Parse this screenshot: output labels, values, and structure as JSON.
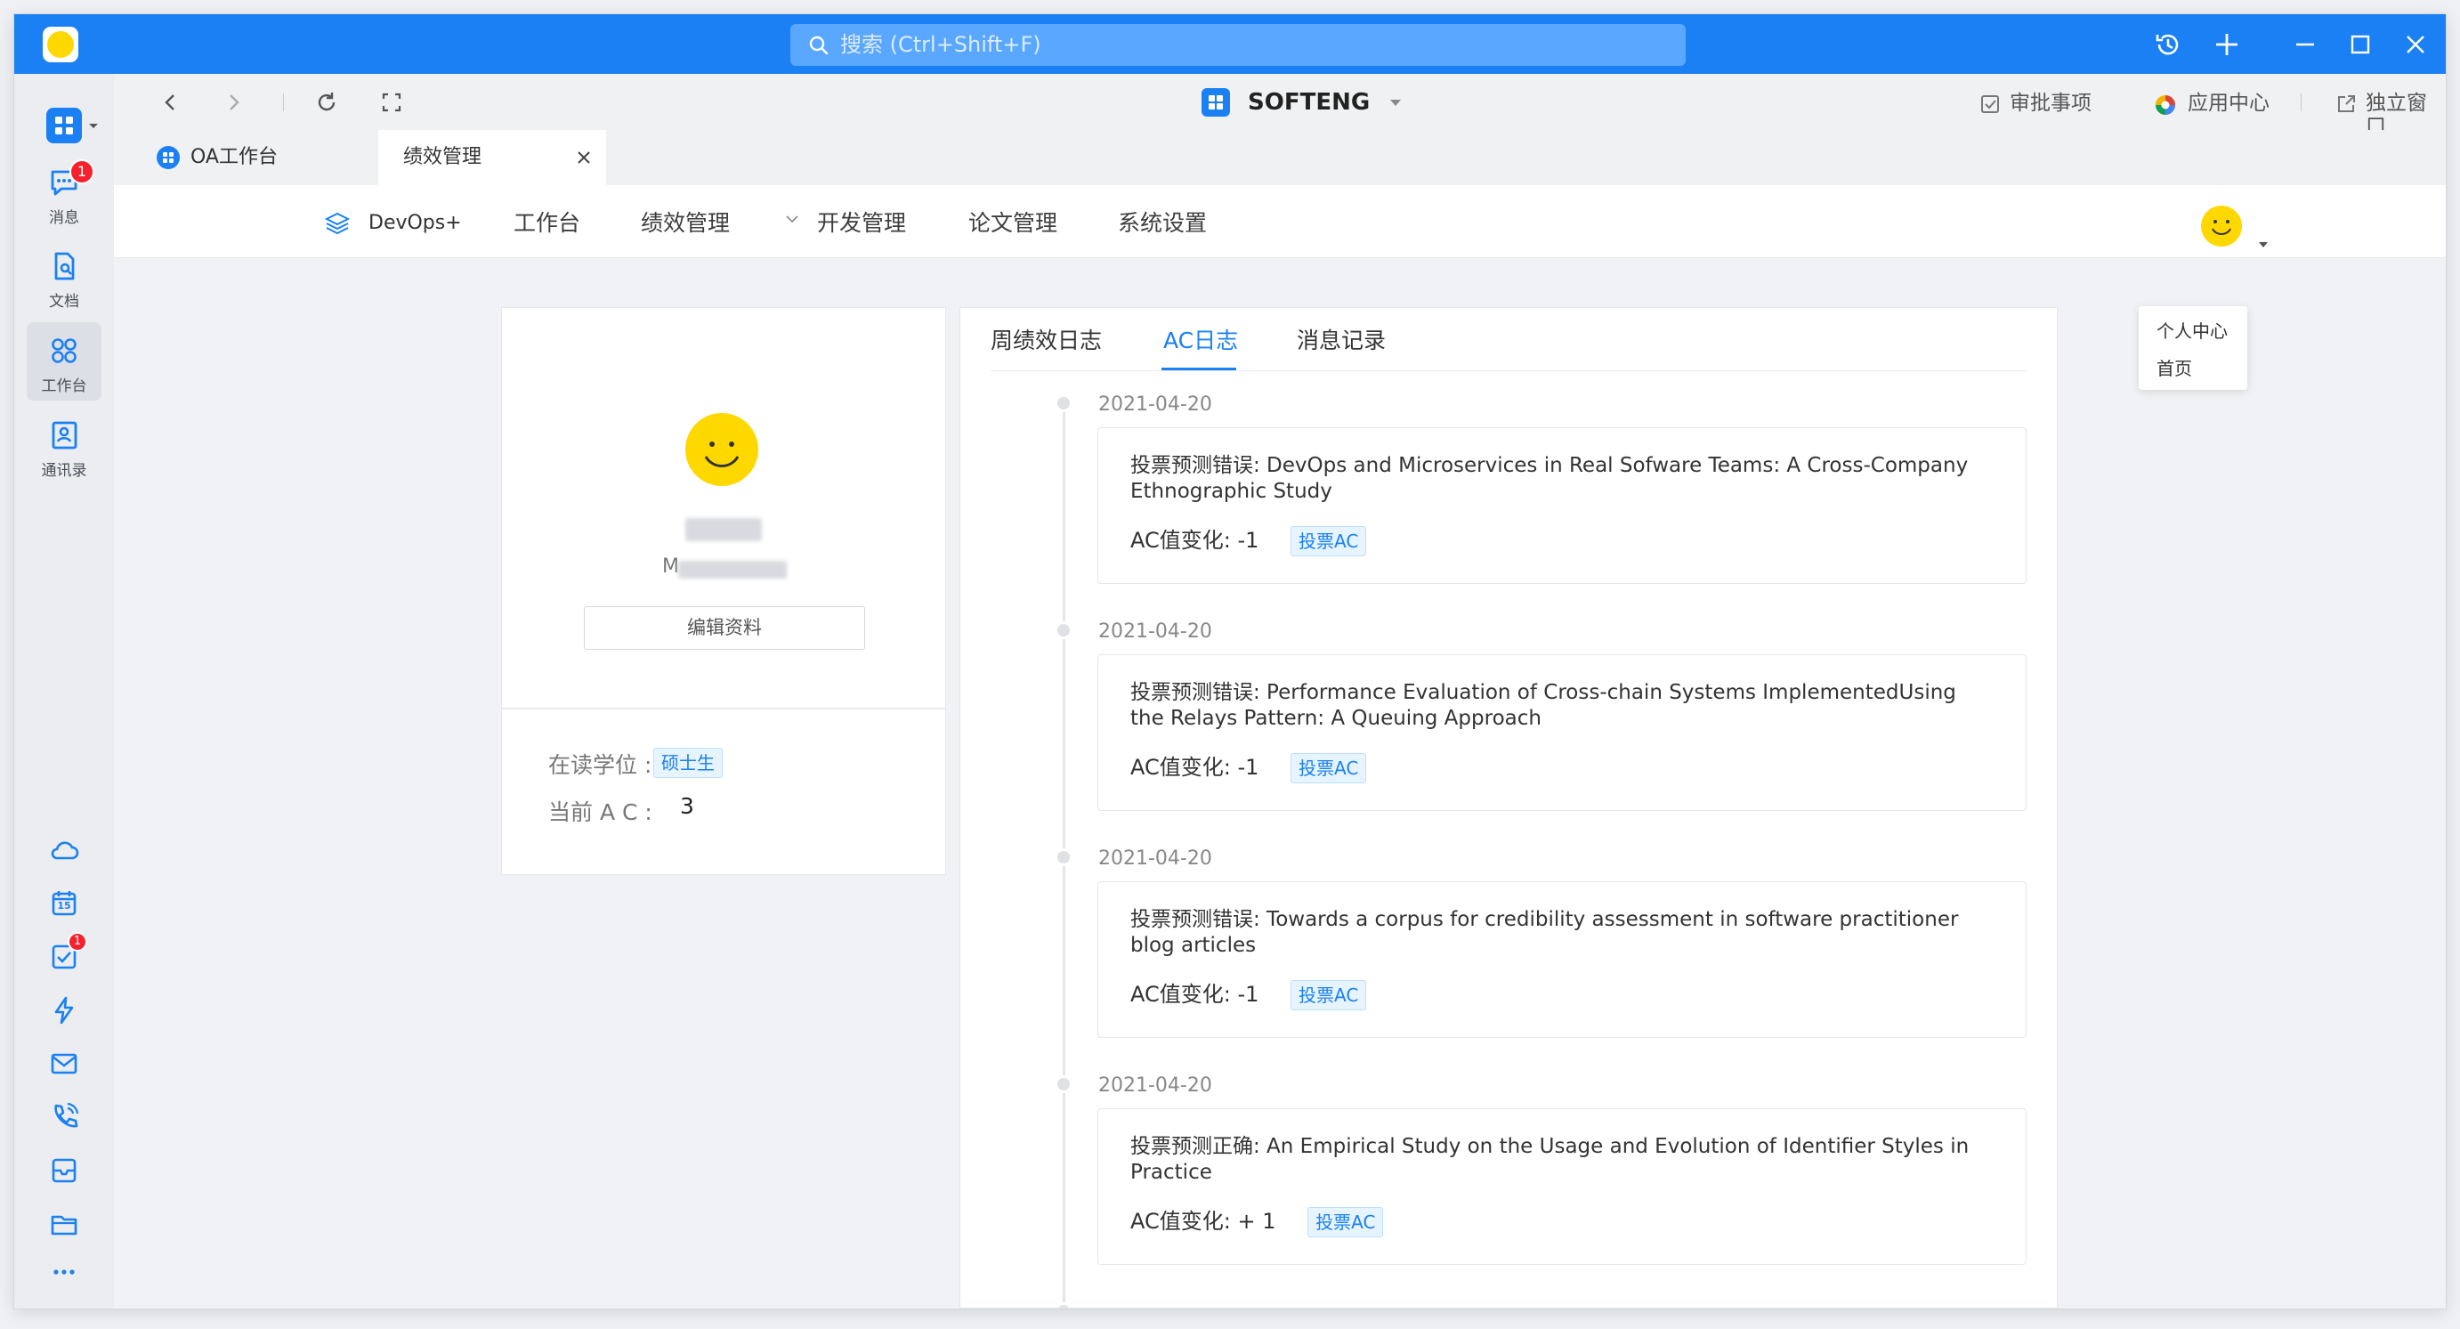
{
  "titlebar": {
    "search_placeholder": "搜索 (Ctrl+Shift+F)"
  },
  "rail": {
    "items": [
      {
        "label": "消息",
        "badge": "1"
      },
      {
        "label": "文档"
      },
      {
        "label": "工作台"
      },
      {
        "label": "通讯录"
      }
    ],
    "calendar_day": "15",
    "task_badge": "1"
  },
  "topbar": {
    "brand": "SOFTENG",
    "approvals": "审批事项",
    "app_center": "应用中心",
    "standalone": "独立窗口"
  },
  "tabs": [
    {
      "label": "OA工作台"
    },
    {
      "label": "绩效管理"
    }
  ],
  "appnav": {
    "logo_text": "DevOps+",
    "items": [
      "工作台",
      "绩效管理",
      "开发管理",
      "论文管理",
      "系统设置"
    ]
  },
  "user_menu": [
    "个人中心",
    "首页"
  ],
  "profile": {
    "id_prefix": "M",
    "edit_label": "编辑资料",
    "degree_label": "在读学位 :",
    "degree_value": "硕士生",
    "ac_label": "当前 A C :",
    "ac_value": "3"
  },
  "log_tabs": [
    "周绩效日志",
    "AC日志",
    "消息记录"
  ],
  "logs": [
    {
      "date": "2021-04-20",
      "title": "投票预测错误:  DevOps and Microservices in Real Sofware Teams: A Cross-Company Ethnographic Study",
      "ac_change": "AC值变化:   -1",
      "tag": "投票AC"
    },
    {
      "date": "2021-04-20",
      "title": "投票预测错误:  Performance Evaluation of Cross-chain Systems ImplementedUsing the Relays Pattern: A Queuing Approach",
      "ac_change": "AC值变化:   -1",
      "tag": "投票AC"
    },
    {
      "date": "2021-04-20",
      "title": "投票预测错误:  Towards a corpus for credibility assessment in software practitioner blog articles",
      "ac_change": "AC值变化:   -1",
      "tag": "投票AC"
    },
    {
      "date": "2021-04-20",
      "title": "投票预测正确:  An Empirical Study on the Usage and Evolution of Identifier Styles in Practice",
      "ac_change": "AC值变化:  + 1",
      "tag": "投票AC"
    }
  ]
}
